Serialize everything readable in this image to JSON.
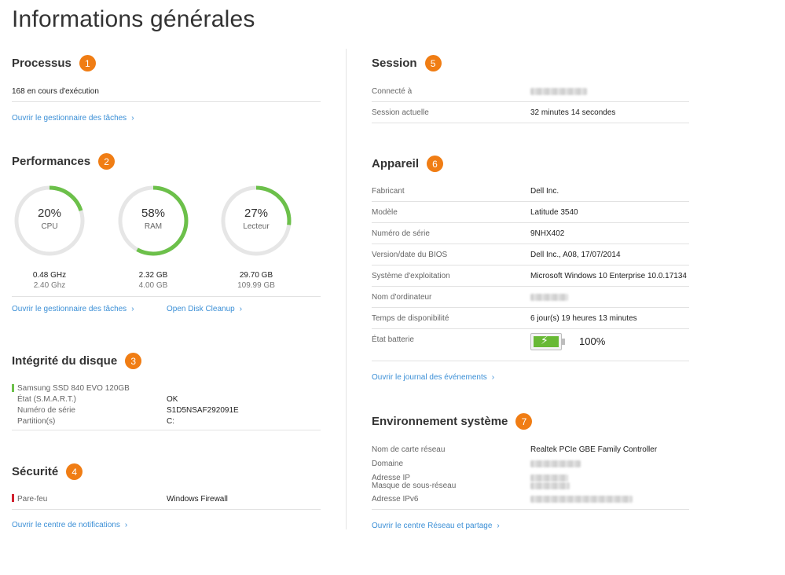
{
  "page_title": "Informations générales",
  "colors": {
    "accent_badge": "#f07d14",
    "link": "#3b8fd6",
    "gauge_fill": "#6cc04a",
    "gauge_track": "#e6e6e6",
    "ok_bar": "#6cc04a",
    "warn_bar": "#d0202e"
  },
  "processus": {
    "title": "Processus",
    "badge": "1",
    "running": "168 en cours d'exécution",
    "link": "Ouvrir le gestionnaire des tâches"
  },
  "performances": {
    "title": "Performances",
    "badge": "2",
    "gauges": [
      {
        "pct": "20%",
        "name": "CPU",
        "value_fraction": 0.2,
        "line1": "0.48 GHz",
        "line2": "2.40 Ghz"
      },
      {
        "pct": "58%",
        "name": "RAM",
        "value_fraction": 0.58,
        "line1": "2.32 GB",
        "line2": "4.00 GB"
      },
      {
        "pct": "27%",
        "name": "Lecteur",
        "value_fraction": 0.27,
        "line1": "29.70 GB",
        "line2": "109.99 GB"
      }
    ],
    "link_taskmgr": "Ouvrir le gestionnaire des tâches",
    "link_disk": "Open Disk Cleanup"
  },
  "disque": {
    "title": "Intégrité du disque",
    "badge": "3",
    "drive": "Samsung SSD 840 EVO 120GB",
    "rows": [
      {
        "label": "État (S.M.A.R.T.)",
        "value": "OK"
      },
      {
        "label": "Numéro de série",
        "value": "S1D5NSAF292091E"
      },
      {
        "label": "Partition(s)",
        "value": "C:"
      }
    ]
  },
  "securite": {
    "title": "Sécurité",
    "badge": "4",
    "firewall_label": "Pare-feu",
    "firewall_value": "Windows Firewall",
    "link": "Ouvrir le centre de notifications"
  },
  "session": {
    "title": "Session",
    "badge": "5",
    "connected_label": "Connecté à",
    "current_label": "Session actuelle",
    "current_value": "32 minutes 14 secondes"
  },
  "appareil": {
    "title": "Appareil",
    "badge": "6",
    "rows": [
      {
        "label": "Fabricant",
        "value": "Dell Inc."
      },
      {
        "label": "Modèle",
        "value": "Latitude 3540"
      },
      {
        "label": "Numéro de série",
        "value": "9NHX402"
      },
      {
        "label": "Version/date du BIOS",
        "value": "Dell Inc., A08, 17/07/2014"
      },
      {
        "label": "Système d'exploitation",
        "value": "Microsoft Windows 10 Enterprise 10.0.17134"
      },
      {
        "label": "Nom d'ordinateur",
        "value": ""
      },
      {
        "label": "Temps de disponibilité",
        "value": "6 jour(s) 19 heures 13 minutes"
      }
    ],
    "battery_label": "État batterie",
    "battery_value": "100%",
    "battery_fraction": 1.0,
    "link": "Ouvrir le journal des événements"
  },
  "environnement": {
    "title": "Environnement système",
    "badge": "7",
    "network_card_label": "Nom de carte réseau",
    "network_card_value": "Realtek PCIe GBE Family Controller",
    "domain_label": "Domaine",
    "ip_label": "Adresse IP",
    "mask_label": "Masque de sous-réseau",
    "ipv6_label": "Adresse IPv6",
    "link": "Ouvrir le centre Réseau et partage"
  }
}
